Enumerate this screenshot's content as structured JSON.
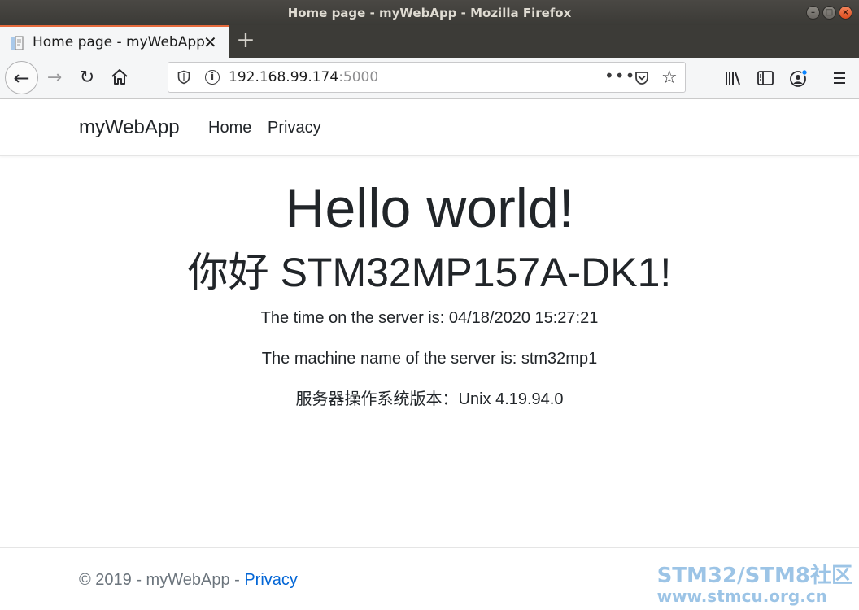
{
  "window": {
    "title": "Home page - myWebApp - Mozilla Firefox",
    "minimize_glyph": "–",
    "maximize_glyph": "□",
    "close_glyph": "×"
  },
  "tabs": [
    {
      "title": "Home page - myWebApp",
      "active": true
    }
  ],
  "tab_close_glyph": "✕",
  "new_tab_glyph": "+",
  "toolbar": {
    "url_host": "192.168.99.174",
    "url_port": ":5000",
    "back_glyph": "←",
    "forward_glyph": "→",
    "reload_glyph": "↻",
    "more_glyph": "•••",
    "star_glyph": "☆",
    "icons": [
      "back-icon",
      "forward-icon",
      "reload-icon",
      "home-icon",
      "shield-icon",
      "info-icon",
      "more-icon",
      "pocket-icon",
      "star-icon",
      "library-icon",
      "sidebar-icon",
      "account-icon",
      "menu-icon"
    ],
    "accent_color": "#e66a3c",
    "account_badge_color": "#0a84ff"
  },
  "site": {
    "brand": "myWebApp",
    "nav": [
      {
        "label": "Home"
      },
      {
        "label": "Privacy"
      }
    ]
  },
  "main": {
    "heading": "Hello world!",
    "greeting": "你好 STM32MP157A-DK1!",
    "time_line": "The time on the server is: 04/18/2020 15:27:21",
    "machine_line": "The machine name of the server is: stm32mp1",
    "os_line": "服务器操作系统版本：Unix 4.19.94.0"
  },
  "footer": {
    "copyright": "© 2019 - myWebApp - ",
    "privacy_link": "Privacy",
    "link_color": "#0366d6"
  },
  "watermark": {
    "line1": "STM32/STM8社区",
    "line2": "www.stmcu.org.cn",
    "color": "#9cc4e6"
  }
}
